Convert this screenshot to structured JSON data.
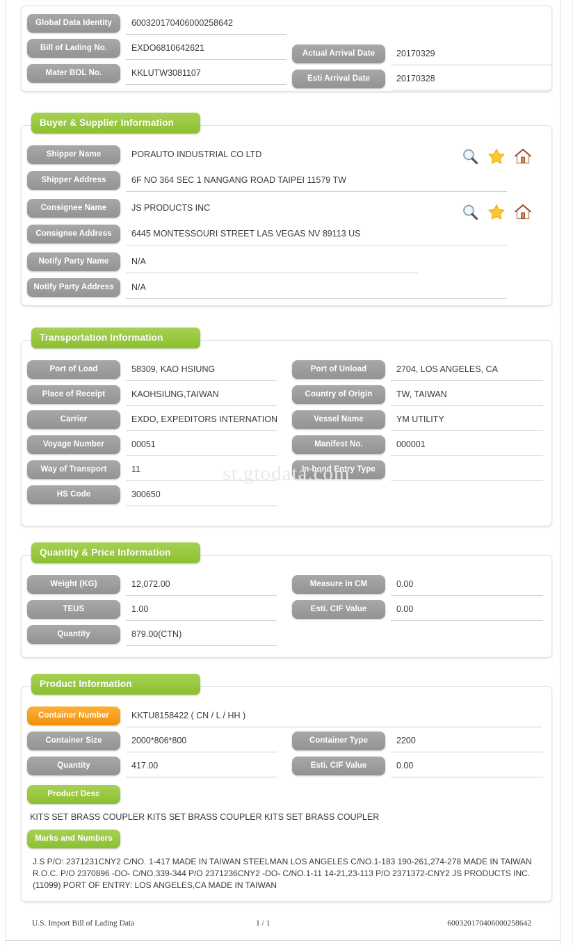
{
  "document": {
    "footer_left": "U.S. Import Bill of Lading Data",
    "footer_page": "1 / 1",
    "footer_right": "600320170406000258642",
    "watermark": "st.gtodata.com"
  },
  "header_card": {
    "rows": [
      {
        "label": "Global Data Identity",
        "value": "600320170406000258642"
      },
      {
        "label": "Bill of Lading No.",
        "value": "EXDO6810642621"
      },
      {
        "label": "Mater BOL No.",
        "value": "KKLUTW3081107"
      }
    ],
    "right_rows": [
      {
        "label": "Actual Arrival Date",
        "value": "20170329"
      },
      {
        "label": "Esti Arrival Date",
        "value": "20170328"
      }
    ]
  },
  "buyer_supplier": {
    "title": "Buyer & Supplier Information",
    "rows": [
      {
        "label": "Shipper Name",
        "value": "PORAUTO INDUSTRIAL CO LTD"
      },
      {
        "label": "Shipper Address",
        "value": "6F NO 364 SEC 1 NANGANG ROAD TAIPEI 11579 TW"
      },
      {
        "label": "Consignee Name",
        "value": "JS PRODUCTS INC"
      },
      {
        "label": "Consignee Address",
        "value": "6445 MONTESSOURI STREET LAS VEGAS NV 89113 US"
      },
      {
        "label": "Notify Party Name",
        "value": "N/A"
      },
      {
        "label": "Notify Party Address",
        "value": "N/A"
      }
    ],
    "icons": [
      "search-icon",
      "star-icon",
      "home-icon"
    ]
  },
  "transportation": {
    "title": "Transportation Information",
    "left_rows": [
      {
        "label": "Port of Load",
        "value": "58309, KAO HSIUNG"
      },
      {
        "label": "Place of Receipt",
        "value": "KAOHSIUNG,TAIWAN"
      },
      {
        "label": "Carrier",
        "value": "EXDO, EXPEDITORS INTERNATIONAL"
      },
      {
        "label": "Voyage Number",
        "value": "00051"
      },
      {
        "label": "Way of Transport",
        "value": "11"
      },
      {
        "label": "HS Code",
        "value": "300650"
      }
    ],
    "right_rows": [
      {
        "label": "Port of Unload",
        "value": "2704, LOS ANGELES, CA"
      },
      {
        "label": "Country of Origin",
        "value": "TW, TAIWAN"
      },
      {
        "label": "Vessel Name",
        "value": "YM UTILITY"
      },
      {
        "label": "Manifest No.",
        "value": "000001"
      },
      {
        "label": "In-bond Entry Type",
        "value": ""
      }
    ]
  },
  "quantity_price": {
    "title": "Quantity & Price Information",
    "left_rows": [
      {
        "label": "Weight (KG)",
        "value": "12,072.00"
      },
      {
        "label": "TEUS",
        "value": "1.00"
      },
      {
        "label": "Quantity",
        "value": "879.00(CTN)"
      }
    ],
    "right_rows": [
      {
        "label": "Measure in CM",
        "value": "0.00"
      },
      {
        "label": "Esti. CIF Value",
        "value": "0.00"
      }
    ]
  },
  "product": {
    "title": "Product Information",
    "container_number": {
      "label": "Container Number",
      "value": "KKTU8158422 ( CN / L / HH )"
    },
    "left_rows": [
      {
        "label": "Container Size",
        "value": "2000*806*800"
      },
      {
        "label": "Quantity",
        "value": "417.00"
      }
    ],
    "right_rows": [
      {
        "label": "Container Type",
        "value": "2200"
      },
      {
        "label": "Esti. CIF Value",
        "value": "0.00"
      }
    ],
    "product_desc_label": "Product Desc",
    "product_desc_value": "KITS SET BRASS COUPLER KITS SET BRASS COUPLER KITS SET BRASS COUPLER",
    "marks_label": "Marks and Numbers",
    "marks_value": "J.S P/O: 2371231CNY2 C/NO. 1-417 MADE IN TAIWAN STEELMAN LOS ANGELES C/NO.1-183 190-261,274-278 MADE IN TAIWAN R.O.C. P/O 2370896 -DO- C/NO.339-344 P/O 2371236CNY2 -DO- C/NO.1-11 14-21,23-113 P/O 2371372-CNY2 JS PRODUCTS INC. (11099) PORT OF ENTRY: LOS ANGELES,CA MADE IN TAIWAN"
  },
  "colors": {
    "green": "#96c83c",
    "gray": "#9d9d9d",
    "orange": "#f5a11a"
  }
}
